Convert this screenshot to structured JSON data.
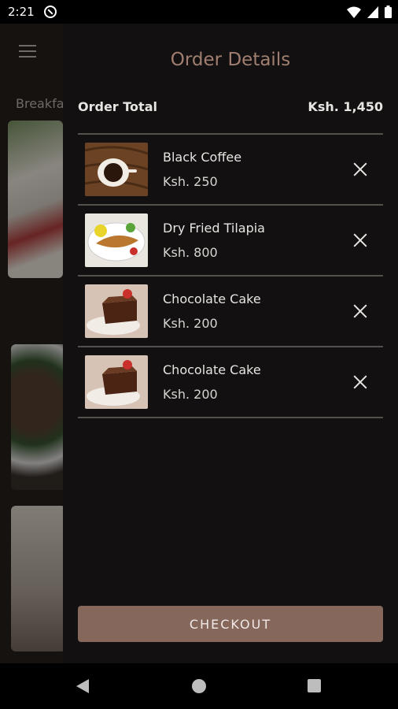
{
  "status_bar": {
    "time": "2:21"
  },
  "background": {
    "tab_label": "Breakfa"
  },
  "drawer": {
    "title": "Order Details",
    "order_total_label": "Order Total",
    "order_total_value": "Ksh. 1,450",
    "items": [
      {
        "name": "Black Coffee",
        "price": "Ksh. 250"
      },
      {
        "name": "Dry Fried Tilapia",
        "price": "Ksh. 800"
      },
      {
        "name": "Chocolate Cake",
        "price": "Ksh. 200"
      },
      {
        "name": "Chocolate Cake",
        "price": "Ksh. 200"
      }
    ],
    "checkout_label": "CHECKOUT"
  },
  "colors": {
    "accent": "#a07f70",
    "button": "#86675c",
    "drawer_bg": "#121011"
  }
}
